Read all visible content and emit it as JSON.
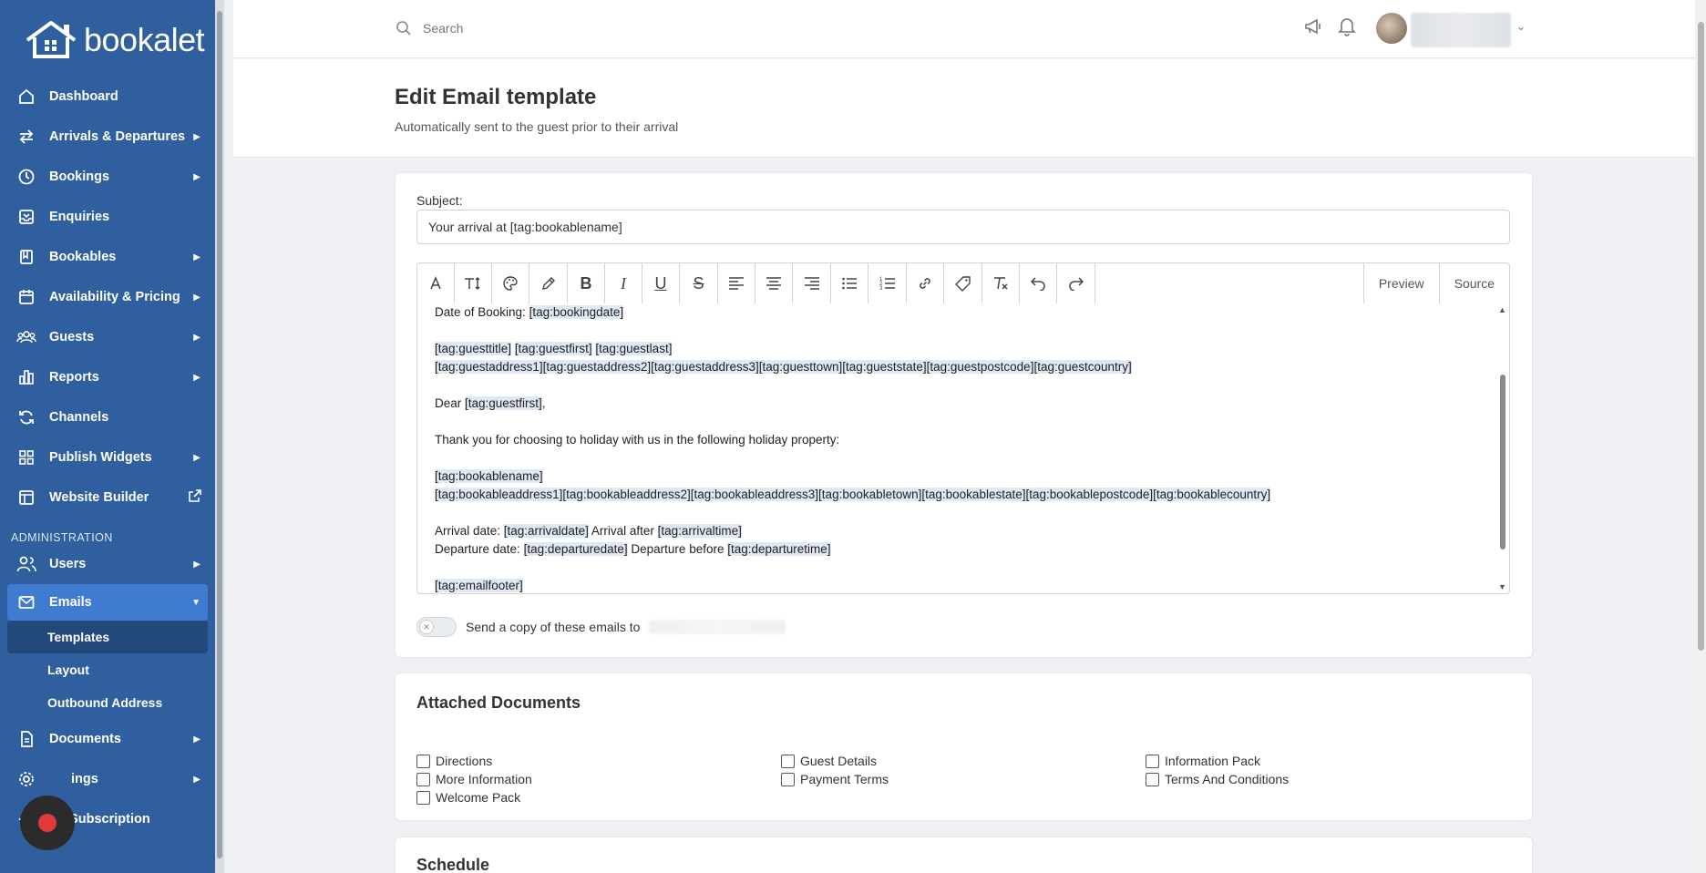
{
  "brand": {
    "name": "bookalet"
  },
  "sidebar": {
    "items": [
      {
        "label": "Dashboard",
        "icon": "home-icon",
        "caret": false
      },
      {
        "label": "Arrivals & Departures",
        "icon": "arrows-icon",
        "caret": true
      },
      {
        "label": "Bookings",
        "icon": "clock-icon",
        "caret": true
      },
      {
        "label": "Enquiries",
        "icon": "inbox-icon",
        "caret": false
      },
      {
        "label": "Bookables",
        "icon": "book-icon",
        "caret": true
      },
      {
        "label": "Availability & Pricing",
        "icon": "calendar-icon",
        "caret": true
      },
      {
        "label": "Guests",
        "icon": "users-icon",
        "caret": true
      },
      {
        "label": "Reports",
        "icon": "bar-chart-icon",
        "caret": true
      },
      {
        "label": "Channels",
        "icon": "refresh-icon",
        "caret": false
      },
      {
        "label": "Publish Widgets",
        "icon": "widgets-icon",
        "caret": true
      },
      {
        "label": "Website Builder",
        "icon": "browser-icon",
        "caret": false
      }
    ],
    "admin_heading": "ADMINISTRATION",
    "admin_items": [
      {
        "label": "Users",
        "icon": "user-icon"
      },
      {
        "label": "Emails",
        "icon": "mail-icon"
      }
    ],
    "email_subitems": [
      "Templates",
      "Layout",
      "Outbound Address"
    ],
    "bottom_items": [
      {
        "label": "Documents",
        "icon": "document-icon"
      },
      {
        "label": "ings",
        "icon": "gear-icon"
      },
      {
        "label": "y Subscription",
        "icon": "star-icon"
      }
    ]
  },
  "topbar": {
    "search_placeholder": "Search"
  },
  "header": {
    "title": "Edit Email template",
    "subtitle": "Automatically sent to the guest prior to their arrival"
  },
  "form": {
    "subject_label": "Subject:",
    "subject_value": "Your arrival at [tag:bookablename]",
    "preview_label": "Preview",
    "source_label": "Source",
    "copy_label": "Send a copy of these emails to"
  },
  "editor": {
    "l1a": "Date of Booking: ",
    "l1b": "[tag:bookingdate]",
    "l2a": "[tag:guesttitle]",
    "l2b": " ",
    "l2c": "[tag:guestfirst]",
    "l2d": " ",
    "l2e": "[tag:guestlast]",
    "l3": "[tag:guestaddress1][tag:guestaddress2][tag:guestaddress3][tag:guesttown][tag:gueststate][tag:guestpostcode][tag:guestcountry]",
    "l4a": "Dear ",
    "l4b": "[tag:guestfirst]",
    "l4c": ",",
    "l5": "Thank you for choosing to holiday with us in the following holiday property:",
    "l6": "[tag:bookablename]",
    "l7": "[tag:bookableaddress1][tag:bookableaddress2][tag:bookableaddress3][tag:bookabletown][tag:bookablestate][tag:bookablepostcode][tag:bookablecountry]",
    "l8a": "Arrival date: ",
    "l8b": "[tag:arrivaldate]",
    "l8c": " Arrival after ",
    "l8d": "[tag:arrivaltime]",
    "l9a": "Departure date: ",
    "l9b": "[tag:departuredate]",
    "l9c": " Departure before ",
    "l9d": "[tag:departuretime]",
    "l10": "[tag:emailfooter]"
  },
  "attached": {
    "title": "Attached Documents",
    "docs": [
      "Directions",
      "Guest Details",
      "Information Pack",
      "More Information",
      "Payment Terms",
      "Terms And Conditions",
      "Welcome Pack"
    ]
  },
  "schedule": {
    "title": "Schedule"
  },
  "colors": {
    "sidebar": "#2f5f9e",
    "active": "#3f7bd0",
    "sub_active": "#23487a",
    "tag_highlight": "#dfe8f5"
  }
}
